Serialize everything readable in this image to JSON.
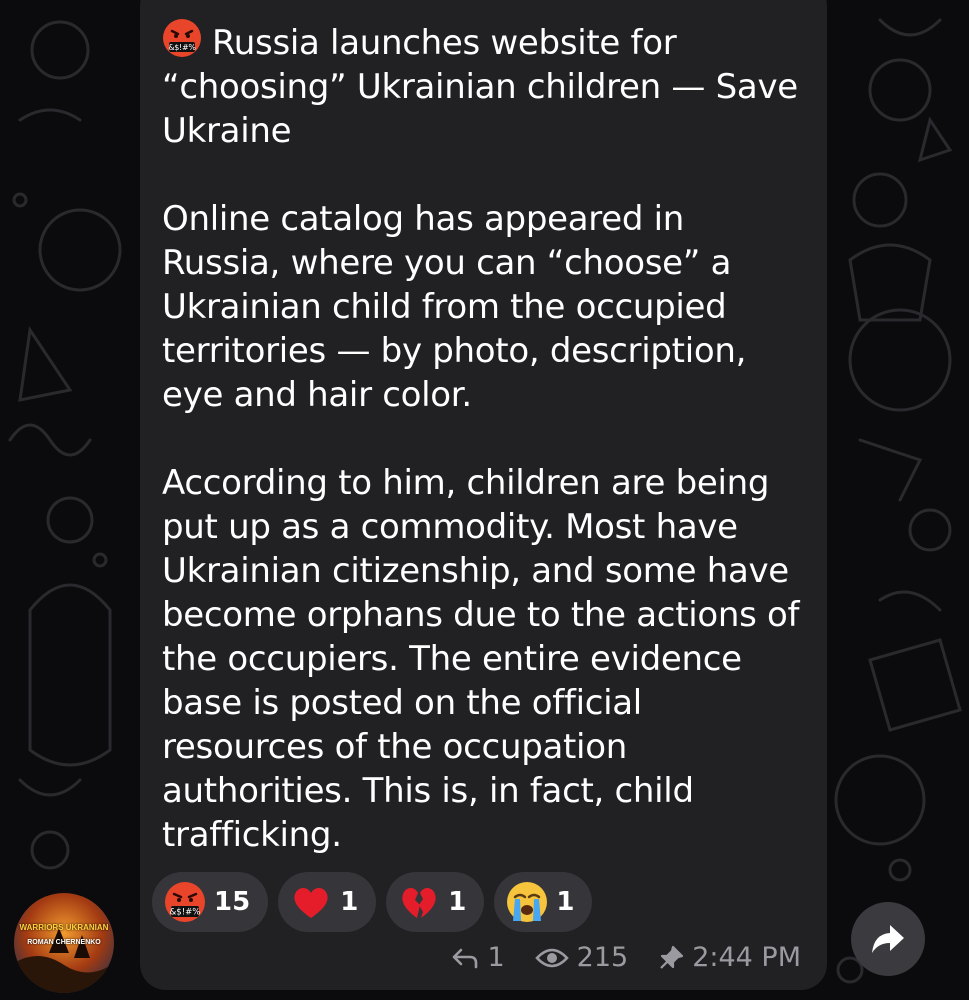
{
  "message": {
    "title": "Russia launches website for “choosing” Ukrainian children — Save Ukraine",
    "paragraph_1": "Online catalog has appeared in Russia, where you can “choose” a Ukrainian child from the occupied territories — by photo, description, eye and hair color.",
    "paragraph_2": "According to him, children are being put up as a commodity. Most have Ukrainian citizenship, and some have become orphans due to the actions of the occupiers. The entire evidence base is posted on the official resources of the occupation authorities. This is, in fact, child trafficking."
  },
  "reactions": [
    {
      "icon": "cursing-face-icon",
      "count": "15"
    },
    {
      "icon": "red-heart-icon",
      "count": "1"
    },
    {
      "icon": "broken-heart-icon",
      "count": "1"
    },
    {
      "icon": "loudly-crying-face-icon",
      "count": "1"
    }
  ],
  "meta": {
    "replies": "1",
    "views": "215",
    "time": "2:44 PM"
  },
  "avatar": {
    "line1": "WARRIORS UKRANIAN",
    "line2": "ROMAN CHERNENKO"
  },
  "colors": {
    "bubble": "#212124",
    "reaction_pill": "#35353a",
    "meta_text": "#9a9aa0",
    "background": "#0b0b0d"
  }
}
